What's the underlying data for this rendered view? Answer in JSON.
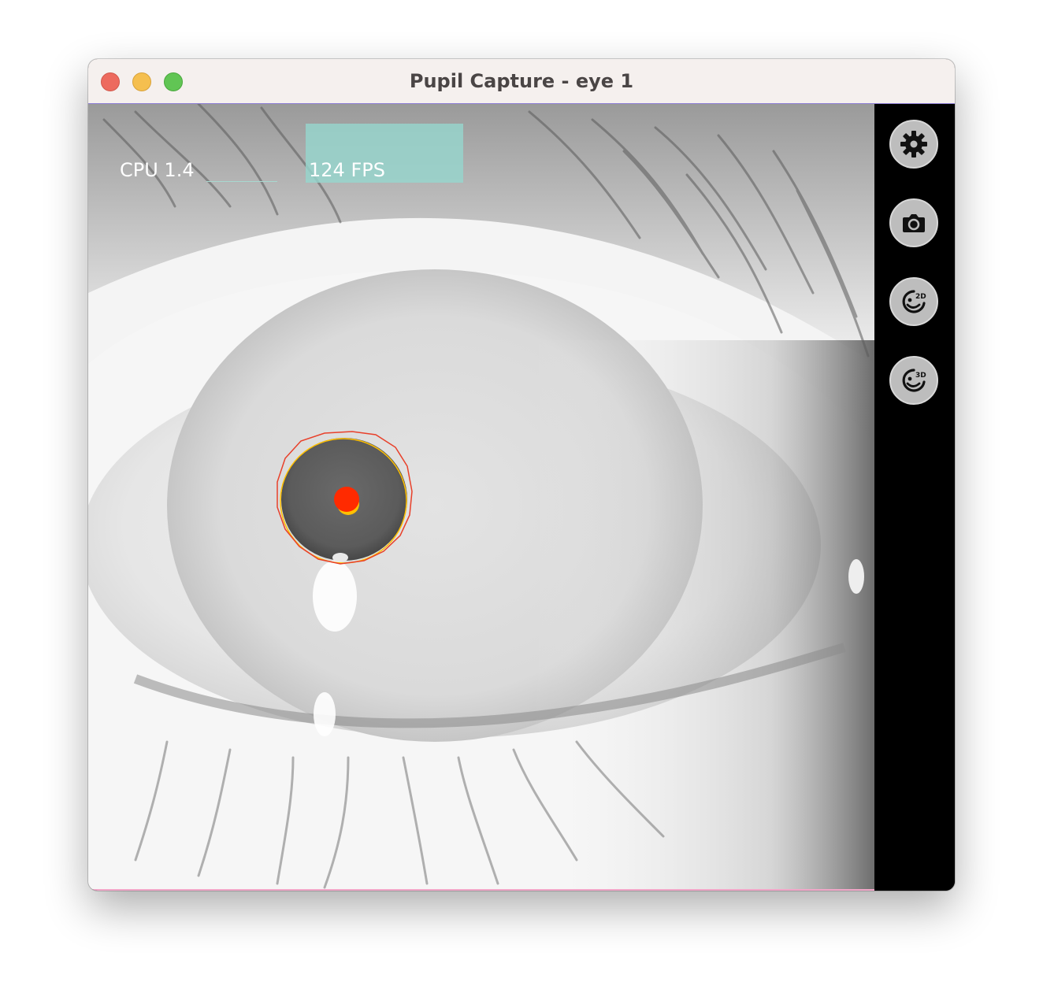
{
  "window": {
    "title": "Pupil Capture - eye 1"
  },
  "overlay": {
    "cpu_label": "CPU 1.4",
    "fps_label": "124 FPS"
  },
  "sidebar": {
    "buttons": [
      {
        "icon": "gear-icon",
        "name": "settings-button"
      },
      {
        "icon": "camera-icon",
        "name": "snapshot-button"
      },
      {
        "icon": "detector-2d-icon",
        "name": "pupil-detector-2d-button",
        "badge": "2D"
      },
      {
        "icon": "detector-3d-icon",
        "name": "pupil-detector-3d-button",
        "badge": "3D"
      }
    ]
  },
  "colors": {
    "pupil_center": "#ff2a00",
    "ellipse_2d": "#ffc000",
    "ellipse_3d": "#e8402a",
    "fps_bar": "#96d6cd"
  }
}
